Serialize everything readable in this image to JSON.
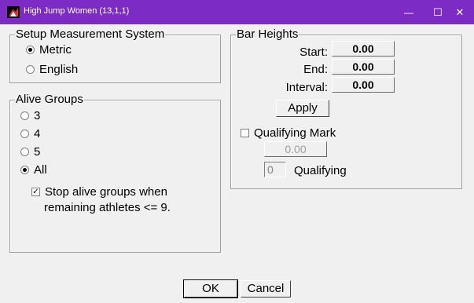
{
  "window": {
    "title": "High Jump Women (13,1,1)",
    "minimize_glyph": "—",
    "maximize_glyph": "☐",
    "close_glyph": "✕",
    "accent": "#7c2bc4"
  },
  "measurement": {
    "legend": "Setup Measurement System",
    "metric_label": "Metric",
    "english_label": "English",
    "selected": "Metric"
  },
  "alive_groups": {
    "legend": "Alive Groups",
    "options": [
      "3",
      "4",
      "5",
      "All"
    ],
    "selected": "All",
    "stop_checkbox_line1": "Stop alive groups when",
    "stop_checkbox_line2": "remaining athletes <=  9.",
    "stop_checked": true,
    "check_glyph": "✓"
  },
  "bar_heights": {
    "legend": "Bar Heights",
    "start_label": "Start:",
    "start_value": "0.00",
    "end_label": "End:",
    "end_value": "0.00",
    "interval_label": "Interval:",
    "interval_value": "0.00",
    "apply_label": "Apply",
    "qualifying_mark_label": "Qualifying Mark",
    "qualifying_mark_checked": false,
    "qualifying_mark_value": "0.00",
    "qualifying_count": "0",
    "qualifying_label": "Qualifying"
  },
  "footer": {
    "ok_label": "OK",
    "cancel_label": "Cancel"
  }
}
